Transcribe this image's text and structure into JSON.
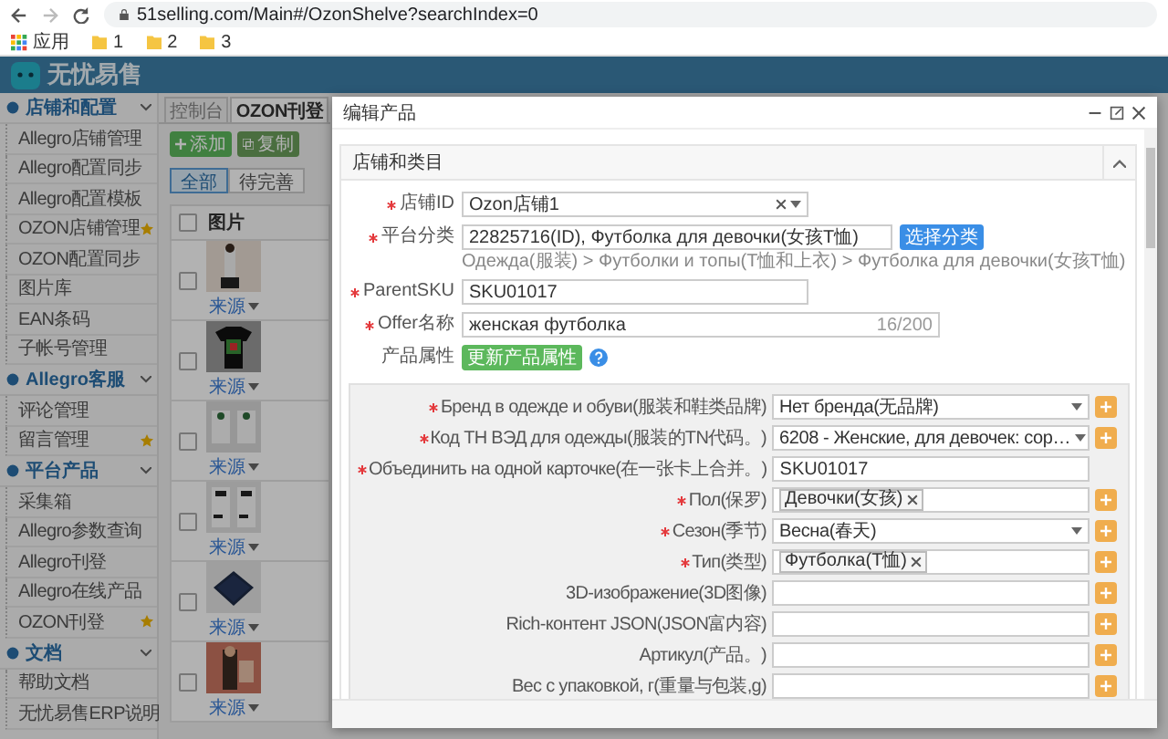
{
  "browser": {
    "url": "51selling.com/Main#/OzonShelve?searchIndex=0",
    "bookmarks": [
      {
        "kind": "apps",
        "label": "应用"
      },
      {
        "kind": "folder",
        "label": "1"
      },
      {
        "kind": "folder",
        "label": "2"
      },
      {
        "kind": "folder",
        "label": "3"
      }
    ]
  },
  "app": {
    "brand": "无忧易售"
  },
  "sidebar": {
    "groups": [
      {
        "title": "店铺和配置",
        "expanded": true,
        "items": [
          {
            "label": "Allegro店铺管理",
            "starred": false
          },
          {
            "label": "Allegro配置同步",
            "starred": false
          },
          {
            "label": "Allegro配置模板",
            "starred": false
          },
          {
            "label": "OZON店铺管理",
            "starred": true
          },
          {
            "label": "OZON配置同步",
            "starred": false
          },
          {
            "label": "图片库",
            "starred": false
          },
          {
            "label": "EAN条码",
            "starred": false
          },
          {
            "label": "子帐号管理",
            "starred": false
          }
        ]
      },
      {
        "title": "Allegro客服",
        "expanded": true,
        "items": [
          {
            "label": "评论管理",
            "starred": false
          },
          {
            "label": "留言管理",
            "starred": true
          }
        ]
      },
      {
        "title": "平台产品",
        "expanded": true,
        "items": [
          {
            "label": "采集箱",
            "starred": false
          },
          {
            "label": "Allegro参数查询",
            "starred": false
          },
          {
            "label": "Allegro刊登",
            "starred": false
          },
          {
            "label": "Allegro在线产品",
            "starred": false
          },
          {
            "label": "OZON刊登",
            "starred": true
          }
        ]
      },
      {
        "title": "文档",
        "expanded": true,
        "items": [
          {
            "label": "帮助文档",
            "starred": false
          },
          {
            "label": "无忧易售ERP说明",
            "starred": false
          }
        ]
      }
    ]
  },
  "tabs": [
    {
      "label": "控制台",
      "selected": false
    },
    {
      "label": "OZON刊登",
      "selected": true
    }
  ],
  "toolbar": {
    "buttons": [
      {
        "kind": "add",
        "label": "添加"
      },
      {
        "kind": "copy",
        "label": "复制"
      }
    ]
  },
  "filters": [
    {
      "label": "全部",
      "selected": true
    },
    {
      "label": "待完善",
      "selected": false
    }
  ],
  "table": {
    "columns": [
      "图片"
    ],
    "header_checked": false,
    "rows": [
      {
        "checked": false,
        "kind": "picture",
        "link": "来源"
      },
      {
        "checked": false,
        "kind": "picture",
        "link": "来源"
      },
      {
        "checked": false,
        "kind": "picture",
        "link": "来源"
      },
      {
        "checked": false,
        "kind": "picture",
        "link": "来源"
      },
      {
        "checked": false,
        "kind": "picture",
        "link": "来源"
      },
      {
        "checked": false,
        "kind": "picture",
        "link": "来源"
      }
    ]
  },
  "modal": {
    "title": "编辑产品",
    "section": {
      "title": "店铺和类目",
      "expanded": true,
      "fields": [
        {
          "kind": "select",
          "label": "店铺ID",
          "required": true,
          "value": "Ozon店铺1"
        },
        {
          "kind": "category",
          "label": "平台分类",
          "required": true,
          "value": "22825716(ID), Футболка для девочки(女孩T恤)",
          "button": "选择分类",
          "path": "Одежда(服装) > Футболки и топы(T恤和上衣) > Футболка для девочки(女孩T恤)"
        },
        {
          "kind": "text",
          "label": "ParentSKU",
          "required": true,
          "value": "SKU01017"
        },
        {
          "kind": "counter",
          "label": "Offer名称",
          "required": true,
          "value": "женская футболка",
          "count": "16/200"
        }
      ],
      "attributes": {
        "label": "产品属性",
        "button": "更新产品属性",
        "items": [
          {
            "kind": "select",
            "label": "Бренд в одежде и обуви(服装和鞋类品牌)",
            "required": true,
            "addable": true,
            "value": "Нет бренда(无品牌)"
          },
          {
            "kind": "select",
            "label": "Код ТН ВЭД для одежды(服装的TN代码。)",
            "required": true,
            "addable": true,
            "value": "6208 - Женские, для девочек: сор…"
          },
          {
            "kind": "text",
            "label": "Объединить на одной карточке(在一张卡上合并。)",
            "required": true,
            "addable": false,
            "value": "SKU01017"
          },
          {
            "kind": "tags",
            "label": "Пол(保罗)",
            "required": true,
            "addable": true,
            "tags": [
              "Девочки(女孩)"
            ]
          },
          {
            "kind": "select",
            "label": "Сезон(季节)",
            "required": true,
            "addable": true,
            "value": "Весна(春天)"
          },
          {
            "kind": "tags",
            "label": "Тип(类型)",
            "required": true,
            "addable": true,
            "tags": [
              "Футболка(T恤)"
            ]
          },
          {
            "kind": "text",
            "label": "3D-изображение(3D图像)",
            "required": false,
            "addable": true
          },
          {
            "kind": "text",
            "label": "Rich-контент JSON(JSON富内容)",
            "required": false,
            "addable": true
          },
          {
            "kind": "text",
            "label": "Артикул(产品。)",
            "required": false,
            "addable": true
          },
          {
            "kind": "text",
            "label": "Вес с упаковкой, г(重量与包装,g)",
            "required": false,
            "addable": true
          }
        ]
      }
    }
  }
}
